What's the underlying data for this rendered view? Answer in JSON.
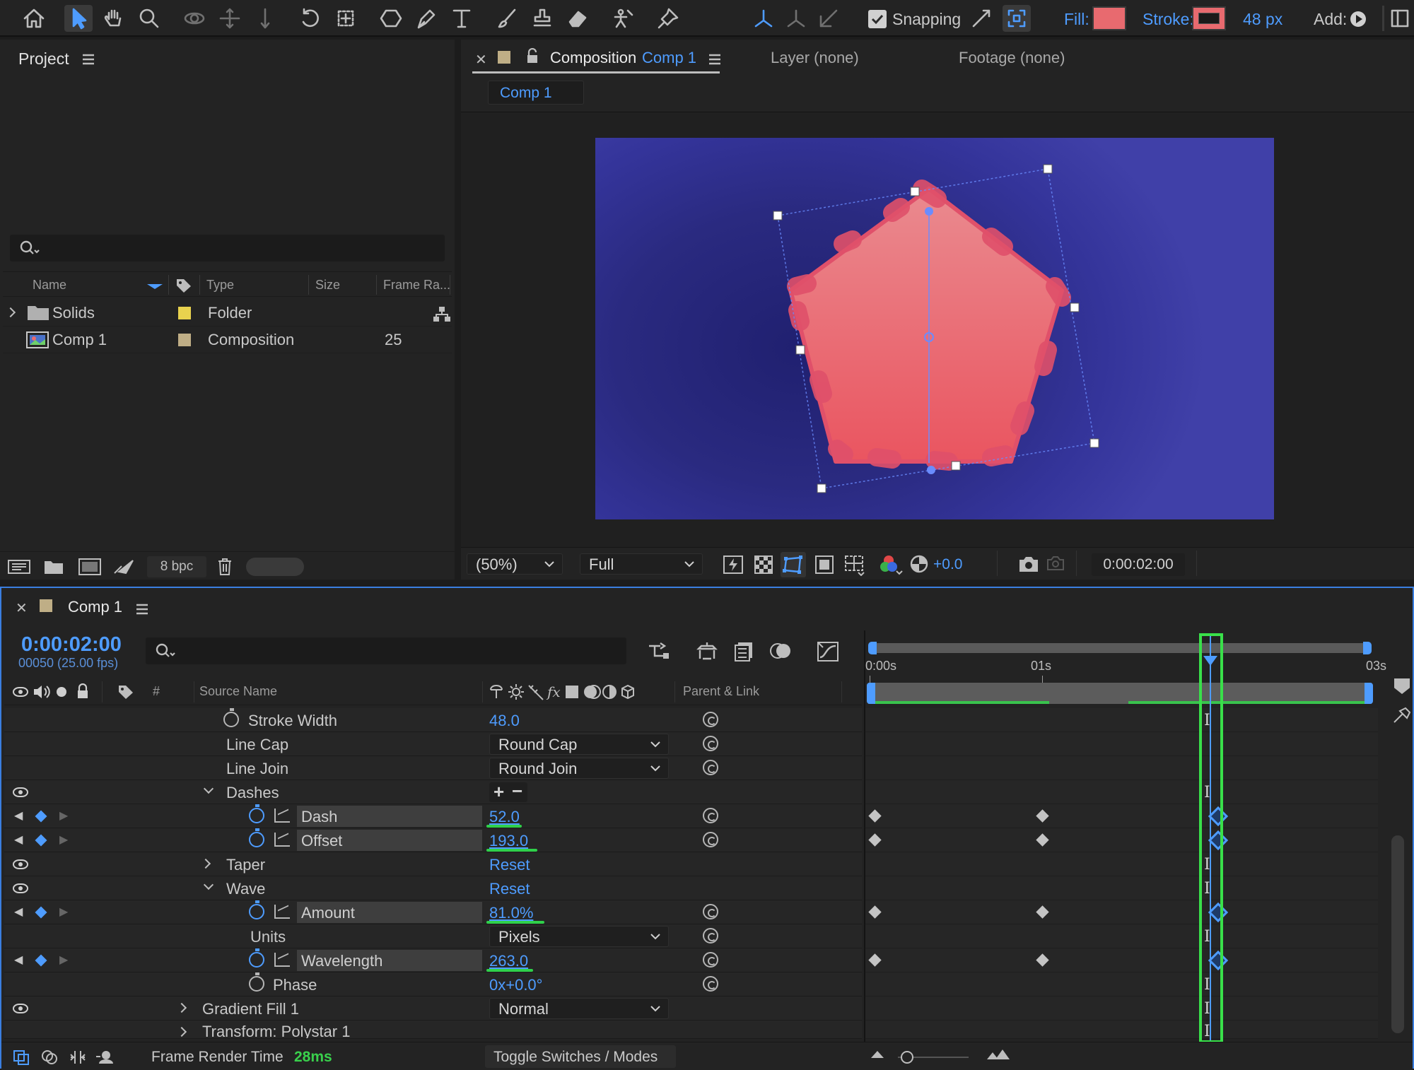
{
  "toolbar": {
    "snapping_label": "Snapping",
    "fill_label": "Fill:",
    "stroke_label": "Stroke:",
    "stroke_px": "48 px",
    "add_label": "Add:",
    "colors": {
      "fill": "#e86a6f",
      "stroke_swatch_border": "#e86a6f",
      "accent": "#4e9cff"
    }
  },
  "project": {
    "title": "Project",
    "search_placeholder": "",
    "columns": [
      "Name",
      "Type",
      "Size",
      "Frame Ra..."
    ],
    "items": [
      {
        "name": "Solids",
        "type": "Folder",
        "size": "",
        "frame_rate": "",
        "label_color": "#e8d24e"
      },
      {
        "name": "Comp 1",
        "type": "Composition",
        "size": "",
        "frame_rate": "25",
        "label_color": "#bfae86"
      }
    ],
    "bpc": "8 bpc"
  },
  "composition": {
    "tab_prefix": "Composition",
    "tab_name": "Comp 1",
    "layer_tab": "Layer (none)",
    "footage_tab": "Footage (none)",
    "breadcrumb": "Comp 1",
    "zoom": "(50%)",
    "resolution": "Full",
    "exposure": "+0.0",
    "timecode": "0:00:02:00"
  },
  "timeline": {
    "tab": "Comp 1",
    "timecode": "0:00:02:00",
    "frame_info": "00050 (25.00 fps)",
    "col_hash": "#",
    "col_source": "Source Name",
    "col_parent": "Parent & Link",
    "ruler": [
      "0:00s",
      "01s",
      "03s"
    ],
    "properties": {
      "stroke_width": {
        "label": "Stroke Width",
        "value": "48.0"
      },
      "line_cap": {
        "label": "Line Cap",
        "value": "Round Cap"
      },
      "line_join": {
        "label": "Line Join",
        "value": "Round Join"
      },
      "dashes": {
        "label": "Dashes"
      },
      "dash": {
        "label": "Dash",
        "value": "52.0"
      },
      "offset": {
        "label": "Offset",
        "value": "193.0"
      },
      "taper": {
        "label": "Taper",
        "value": "Reset"
      },
      "wave": {
        "label": "Wave",
        "value": "Reset"
      },
      "amount": {
        "label": "Amount",
        "value": "81.0%"
      },
      "units": {
        "label": "Units",
        "value": "Pixels"
      },
      "wavelength": {
        "label": "Wavelength",
        "value": "263.0"
      },
      "phase": {
        "label": "Phase",
        "value": "0x+0.0°"
      },
      "gradient_fill": {
        "label": "Gradient Fill 1",
        "value": "Normal"
      },
      "transform": {
        "label": "Transform: Polystar 1"
      }
    },
    "footer": {
      "render_label": "Frame Render Time",
      "render_value": "28ms",
      "toggle_label": "Toggle Switches / Modes"
    }
  }
}
